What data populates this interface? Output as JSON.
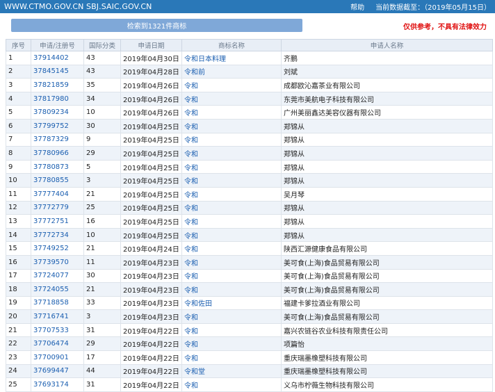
{
  "header": {
    "site": "WWW.CTMO.GOV.CN SBJ.SAIC.GOV.CN",
    "help": "帮助",
    "data_cutoff": "当前数据截至：（2019年05月15日）"
  },
  "result": {
    "label": "检索到1321件商标"
  },
  "disclaimer": "仅供参考，不具有法律效力",
  "table": {
    "columns": [
      "序号",
      "申请/注册号",
      "国际分类",
      "申请日期",
      "商标名称",
      "申请人名称"
    ],
    "rows": [
      [
        "1",
        "37914402",
        "43",
        "2019年04月30日",
        "令和日本料理",
        "齐鹏"
      ],
      [
        "2",
        "37845145",
        "43",
        "2019年04月28日",
        "令和前",
        "刘斌"
      ],
      [
        "3",
        "37821859",
        "35",
        "2019年04月26日",
        "令和",
        "成都欧沁嘉茶业有限公司"
      ],
      [
        "4",
        "37817980",
        "34",
        "2019年04月26日",
        "令和",
        "东莞市美航电子科技有限公司"
      ],
      [
        "5",
        "37809234",
        "10",
        "2019年04月26日",
        "令和",
        "广州美丽鑫达美容仪器有限公司"
      ],
      [
        "6",
        "37799752",
        "30",
        "2019年04月25日",
        "令和",
        "郑锦从"
      ],
      [
        "7",
        "37787329",
        "9",
        "2019年04月25日",
        "令和",
        "郑锦从"
      ],
      [
        "8",
        "37780966",
        "29",
        "2019年04月25日",
        "令和",
        "郑锦从"
      ],
      [
        "9",
        "37780873",
        "5",
        "2019年04月25日",
        "令和",
        "郑锦从"
      ],
      [
        "10",
        "37780855",
        "3",
        "2019年04月25日",
        "令和",
        "郑锦从"
      ],
      [
        "11",
        "37777404",
        "21",
        "2019年04月25日",
        "令和",
        "吴月琴"
      ],
      [
        "12",
        "37772779",
        "25",
        "2019年04月25日",
        "令和",
        "郑锦从"
      ],
      [
        "13",
        "37772751",
        "16",
        "2019年04月25日",
        "令和",
        "郑锦从"
      ],
      [
        "14",
        "37772734",
        "10",
        "2019年04月25日",
        "令和",
        "郑锦从"
      ],
      [
        "15",
        "37749252",
        "21",
        "2019年04月24日",
        "令和",
        "陕西汇源健康食品有限公司"
      ],
      [
        "16",
        "37739570",
        "11",
        "2019年04月23日",
        "令和",
        "美可食(上海)食品贸易有限公司"
      ],
      [
        "17",
        "37724077",
        "30",
        "2019年04月23日",
        "令和",
        "美可食(上海)食品贸易有限公司"
      ],
      [
        "18",
        "37724055",
        "21",
        "2019年04月23日",
        "令和",
        "美可食(上海)食品贸易有限公司"
      ],
      [
        "19",
        "37718858",
        "33",
        "2019年04月23日",
        "令和佐田",
        "福建卡爹拉酒业有限公司"
      ],
      [
        "20",
        "37716741",
        "3",
        "2019年04月23日",
        "令和",
        "美可食(上海)食品贸易有限公司"
      ],
      [
        "21",
        "37707533",
        "31",
        "2019年04月22日",
        "令和",
        "嘉兴农链谷农业科技有限责任公司"
      ],
      [
        "22",
        "37706474",
        "29",
        "2019年04月22日",
        "令和",
        "项篇怡"
      ],
      [
        "23",
        "37700901",
        "17",
        "2019年04月22日",
        "令和",
        "重庆瑞墨橡塑科技有限公司"
      ],
      [
        "24",
        "37699447",
        "44",
        "2019年04月22日",
        "令和堂",
        "重庆瑞墨橡塑科技有限公司"
      ],
      [
        "25",
        "37693174",
        "31",
        "2019年04月22日",
        "令和",
        "义乌市柠薇生物科技有限公司"
      ]
    ]
  }
}
